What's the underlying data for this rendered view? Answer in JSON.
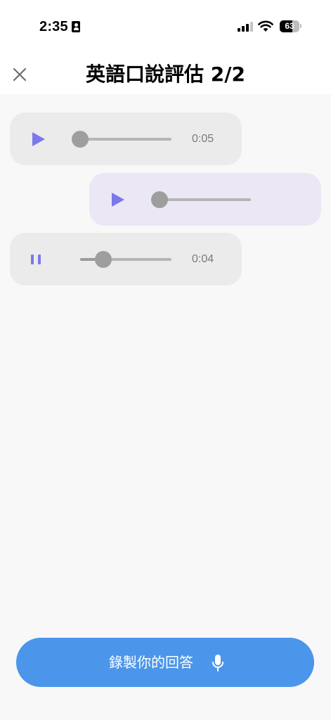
{
  "status_bar": {
    "time": "2:35",
    "battery": "63",
    "battery_level": 0.63,
    "icons": [
      "id-badge-icon",
      "cellular-signal-icon",
      "wifi-icon",
      "battery-icon"
    ]
  },
  "header": {
    "title": "英語口說評估 2/2",
    "close_icon": "close-icon"
  },
  "messages": [
    {
      "direction": "incoming",
      "state": "paused",
      "control_icon": "play-icon",
      "progress": 0.0,
      "duration": "0:05"
    },
    {
      "direction": "outgoing",
      "state": "paused",
      "control_icon": "play-icon",
      "progress": 0.0,
      "duration": ""
    },
    {
      "direction": "incoming",
      "state": "playing",
      "control_icon": "pause-icon",
      "progress": 0.25,
      "duration": "0:04"
    }
  ],
  "record_button": {
    "label": "錄製你的回答",
    "icon": "microphone-icon"
  },
  "colors": {
    "accent": "#4b96ea",
    "play_icon": "#7b78ea",
    "incoming_bubble": "#ebebeb",
    "outgoing_bubble": "#ebe7f5",
    "background": "#f8f8f8"
  }
}
